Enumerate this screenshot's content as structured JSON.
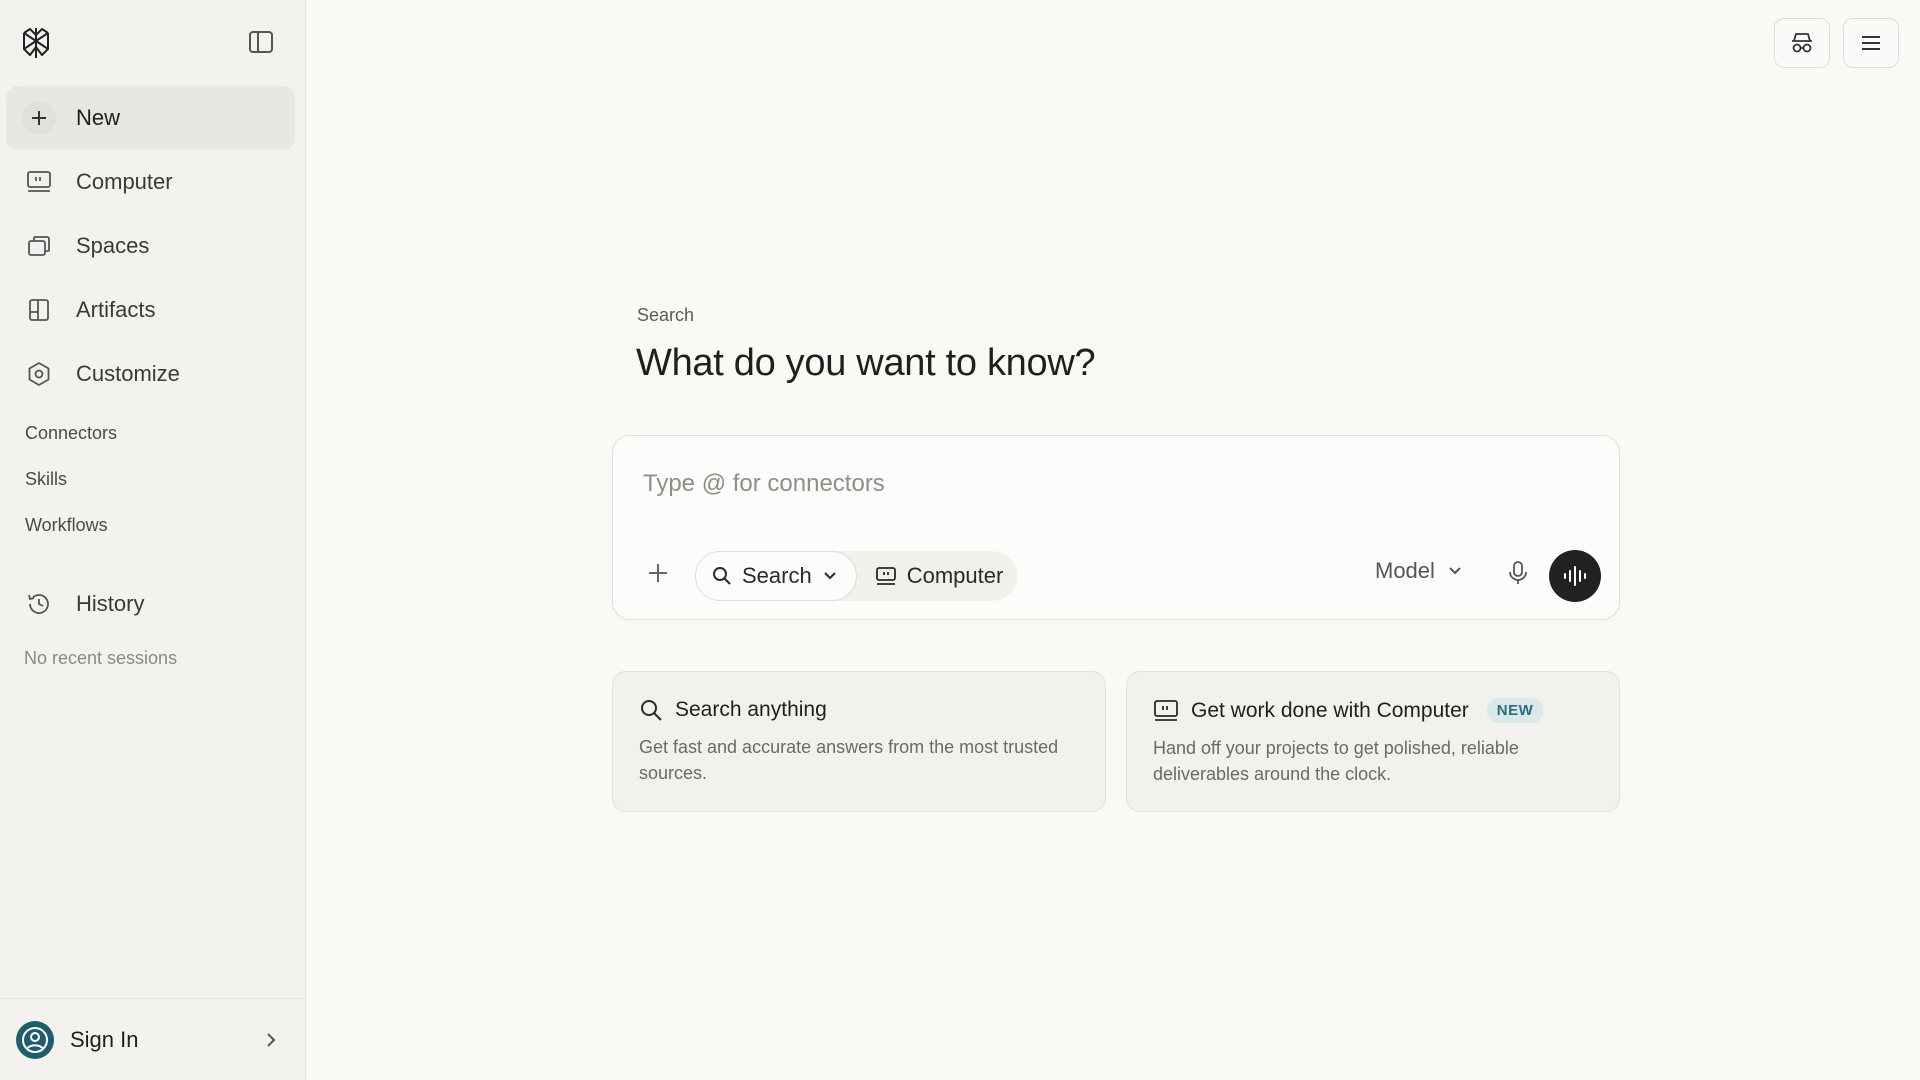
{
  "sidebar": {
    "logo_icon": "perplexity-logo-icon",
    "collapse_icon": "sidebar-toggle-icon",
    "nav": [
      {
        "label": "New",
        "icon": "plus-icon"
      },
      {
        "label": "Computer",
        "icon": "computer-icon"
      },
      {
        "label": "Spaces",
        "icon": "spaces-icon"
      },
      {
        "label": "Artifacts",
        "icon": "artifacts-icon"
      },
      {
        "label": "Customize",
        "icon": "customize-icon"
      }
    ],
    "sub_items": [
      "Connectors",
      "Skills",
      "Workflows"
    ],
    "history": {
      "label": "History",
      "icon": "history-icon"
    },
    "no_recent": "No recent sessions",
    "footer": {
      "label": "Sign In",
      "icon": "user-icon"
    }
  },
  "topbar": {
    "incognito_icon": "incognito-icon",
    "menu_icon": "menu-icon"
  },
  "main": {
    "section_label": "Search",
    "headline": "What do you want to know?",
    "composer": {
      "placeholder": "Type @ for connectors",
      "value": "",
      "mode_search": "Search",
      "mode_computer": "Computer",
      "model_label": "Model"
    },
    "cards": [
      {
        "title": "Search anything",
        "description": "Get fast and accurate answers from the most trusted sources.",
        "icon": "search-icon"
      },
      {
        "title": "Get work done with Computer",
        "badge": "NEW",
        "description": "Hand off your projects to get polished, reliable deliverables around the clock.",
        "icon": "computer-icon"
      }
    ]
  },
  "colors": {
    "background": "#faf9f6",
    "sidebar": "#f3f2ee",
    "accent": "#1e5d6b",
    "voice_button": "#222221"
  }
}
